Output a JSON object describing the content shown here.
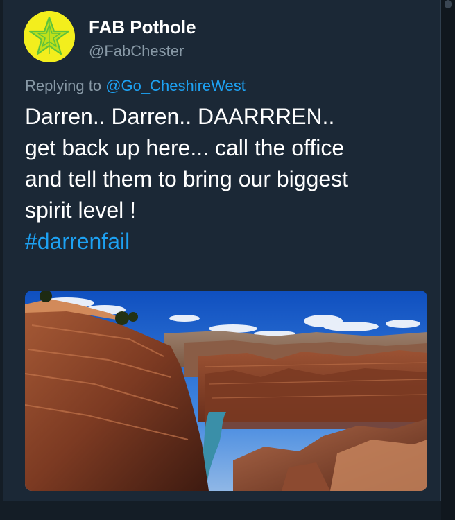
{
  "author": {
    "display_name": "FAB Pothole",
    "handle": "@FabChester",
    "avatar_icon": "yellow-star-badge-icon",
    "avatar_color": "#f3ee1d"
  },
  "reply_context": {
    "prefix": "Replying to",
    "mention": "@Go_CheshireWest"
  },
  "tweet": {
    "lines": [
      "Darren.. Darren.. DAARRREN..",
      "get back up here... call the office",
      "and tell them to bring our biggest",
      "spirit level !"
    ],
    "hashtag": "#darrenfail"
  },
  "media": {
    "kind": "photo",
    "subject": "canyon-landscape"
  },
  "colors": {
    "background": "#141d26",
    "card": "#1b2836",
    "text": "#ffffff",
    "secondary_text": "#8899a6",
    "link": "#1da1f2"
  }
}
